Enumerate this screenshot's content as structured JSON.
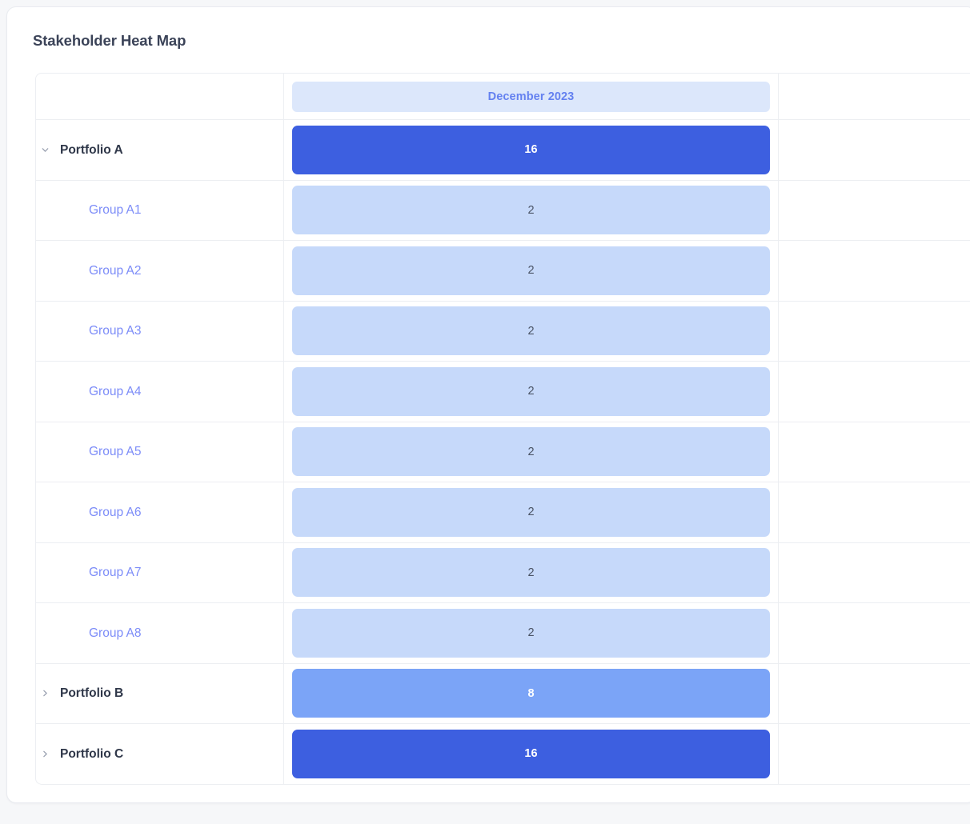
{
  "card": {
    "title": "Stakeholder Heat Map"
  },
  "table": {
    "columns": [
      {
        "key": "label",
        "header": ""
      },
      {
        "key": "december_2023",
        "header": "December 2023"
      },
      {
        "key": "blank",
        "header": ""
      }
    ],
    "rows": [
      {
        "label": "Portfolio A",
        "type": "portfolio",
        "expanded": true,
        "chevron": "chevron-down-icon",
        "value": "16",
        "level": "high"
      },
      {
        "label": "Group A1",
        "type": "group",
        "expanded": false,
        "chevron": "",
        "value": "2",
        "level": "low"
      },
      {
        "label": "Group A2",
        "type": "group",
        "expanded": false,
        "chevron": "",
        "value": "2",
        "level": "low"
      },
      {
        "label": "Group A3",
        "type": "group",
        "expanded": false,
        "chevron": "",
        "value": "2",
        "level": "low"
      },
      {
        "label": "Group A4",
        "type": "group",
        "expanded": false,
        "chevron": "",
        "value": "2",
        "level": "low"
      },
      {
        "label": "Group A5",
        "type": "group",
        "expanded": false,
        "chevron": "",
        "value": "2",
        "level": "low"
      },
      {
        "label": "Group A6",
        "type": "group",
        "expanded": false,
        "chevron": "",
        "value": "2",
        "level": "low"
      },
      {
        "label": "Group A7",
        "type": "group",
        "expanded": false,
        "chevron": "",
        "value": "2",
        "level": "low"
      },
      {
        "label": "Group A8",
        "type": "group",
        "expanded": false,
        "chevron": "",
        "value": "2",
        "level": "low"
      },
      {
        "label": "Portfolio B",
        "type": "portfolio",
        "expanded": false,
        "chevron": "chevron-right-icon",
        "value": "8",
        "level": "mid"
      },
      {
        "label": "Portfolio C",
        "type": "portfolio",
        "expanded": false,
        "chevron": "chevron-right-icon",
        "value": "16",
        "level": "high"
      }
    ]
  },
  "colors": {
    "level_high": "#3d5fe0",
    "level_mid": "#7ba4f7",
    "level_low": "#c6d9fa",
    "header_chip": "#dce7fb",
    "header_text": "#6481f0",
    "group_label": "#7c8cf8",
    "portfolio_label": "#2f3749",
    "card_background": "#ffffff",
    "page_background": "#f6f7f9"
  },
  "chart_data": {
    "type": "heatmap",
    "title": "Stakeholder Heat Map",
    "xlabel": "",
    "ylabel": "",
    "categories": [
      "December 2023"
    ],
    "rows": [
      "Portfolio A",
      "Group A1",
      "Group A2",
      "Group A3",
      "Group A4",
      "Group A5",
      "Group A6",
      "Group A7",
      "Group A8",
      "Portfolio B",
      "Portfolio C"
    ],
    "values": [
      [
        16
      ],
      [
        2
      ],
      [
        2
      ],
      [
        2
      ],
      [
        2
      ],
      [
        2
      ],
      [
        2
      ],
      [
        2
      ],
      [
        2
      ],
      [
        8
      ],
      [
        16
      ]
    ],
    "legend": [],
    "grid": true,
    "color_scale": {
      "2": "#c6d9fa",
      "8": "#7ba4f7",
      "16": "#3d5fe0"
    }
  }
}
